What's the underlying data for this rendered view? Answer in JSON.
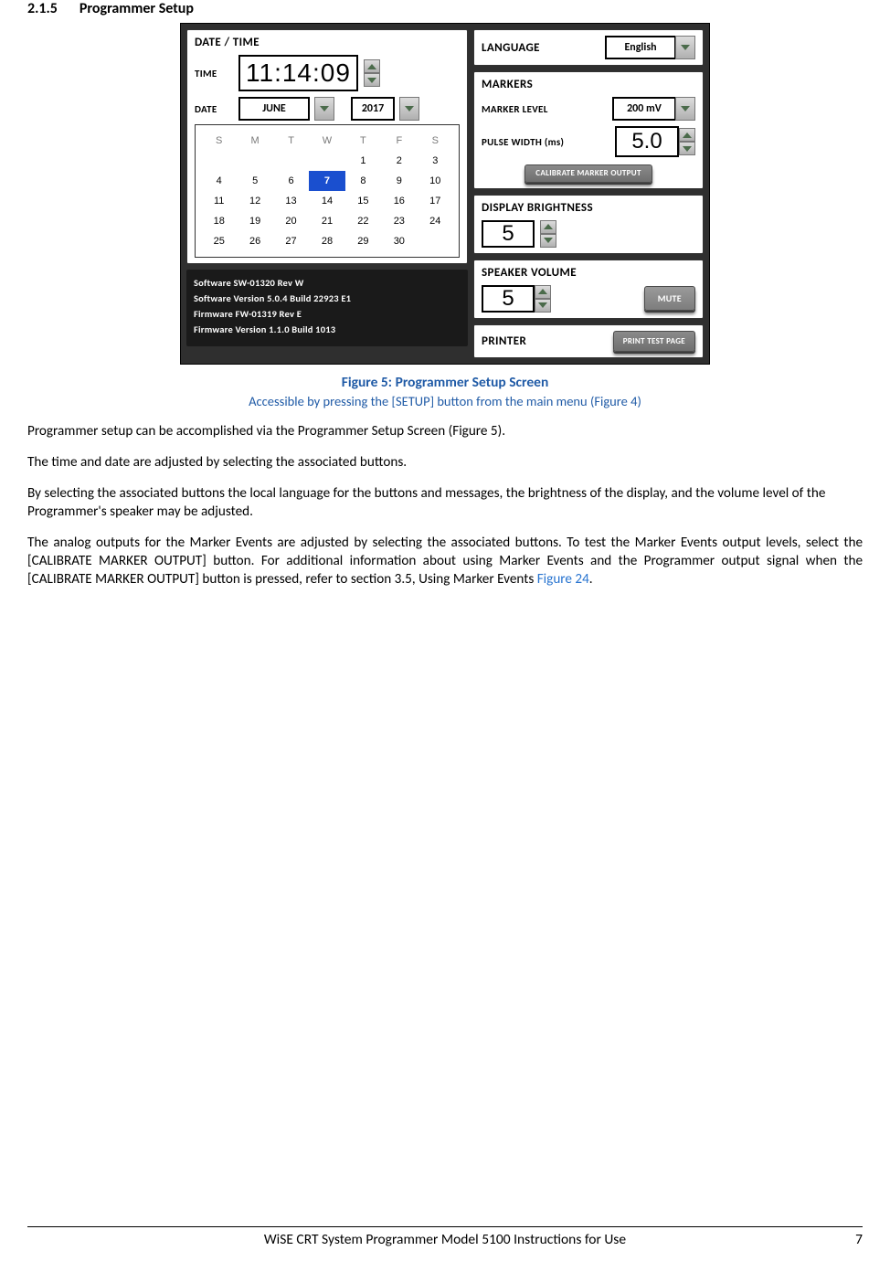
{
  "section": {
    "number": "2.1.5",
    "title": "Programmer Setup"
  },
  "device": {
    "datetime": {
      "panel_title": "DATE / TIME",
      "time_label": "TIME",
      "date_label": "DATE",
      "time_h": "11",
      "time_m": "14",
      "time_s": "09",
      "month": "JUNE",
      "year": "2017",
      "dow": [
        "S",
        "M",
        "T",
        "W",
        "T",
        "F",
        "S"
      ],
      "weeks": [
        [
          "",
          "",
          "",
          "",
          "1",
          "2",
          "3"
        ],
        [
          "4",
          "5",
          "6",
          "7",
          "8",
          "9",
          "10"
        ],
        [
          "11",
          "12",
          "13",
          "14",
          "15",
          "16",
          "17"
        ],
        [
          "18",
          "19",
          "20",
          "21",
          "22",
          "23",
          "24"
        ],
        [
          "25",
          "26",
          "27",
          "28",
          "29",
          "30",
          ""
        ]
      ],
      "selected_day": "7"
    },
    "software": {
      "l1": "Software SW-01320 Rev W",
      "l2": "Software Version 5.0.4 Build 22923 E1",
      "l3": "Firmware FW-01319 Rev E",
      "l4": "Firmware Version 1.1.0 Build 1013"
    },
    "language": {
      "panel_title": "LANGUAGE",
      "value": "English"
    },
    "markers": {
      "panel_title": "MARKERS",
      "level_label": "MARKER LEVEL",
      "level_value": "200 mV",
      "pw_label": "PULSE WIDTH (ms)",
      "pw_value": "5.0",
      "calibrate_label": "CALIBRATE MARKER OUTPUT"
    },
    "brightness": {
      "panel_title": "DISPLAY BRIGHTNESS",
      "value": "5"
    },
    "volume": {
      "panel_title": "SPEAKER VOLUME",
      "value": "5",
      "mute_label": "MUTE"
    },
    "printer": {
      "panel_title": "PRINTER",
      "button_label": "PRINT TEST PAGE"
    }
  },
  "figure": {
    "title": "Figure 5: Programmer Setup Screen",
    "subtitle": "Accessible by pressing the [SETUP] button from the main menu (Figure 4)"
  },
  "body": {
    "p1": "Programmer setup can be accomplished via the Programmer Setup Screen (Figure 5).",
    "p2": "The time and date are adjusted by selecting the associated buttons.",
    "p3": "By selecting the associated buttons the local language for the buttons and messages, the brightness of the display, and the volume level of the Programmer's speaker may be adjusted.",
    "p4a": "The analog outputs for the Marker Events are adjusted by selecting the associated buttons.  To test the Marker Events output levels, select the [CALIBRATE MARKER OUTPUT] button. For additional information about using Marker Events and the Programmer output signal when the [CALIBRATE MARKER OUTPUT] button is pressed, refer to section 3.5, Using Marker Events ",
    "p4_link": "Figure 24",
    "p4b": "."
  },
  "footer": {
    "text": "WiSE CRT System Programmer Model 5100 Instructions for Use",
    "page": "7"
  }
}
